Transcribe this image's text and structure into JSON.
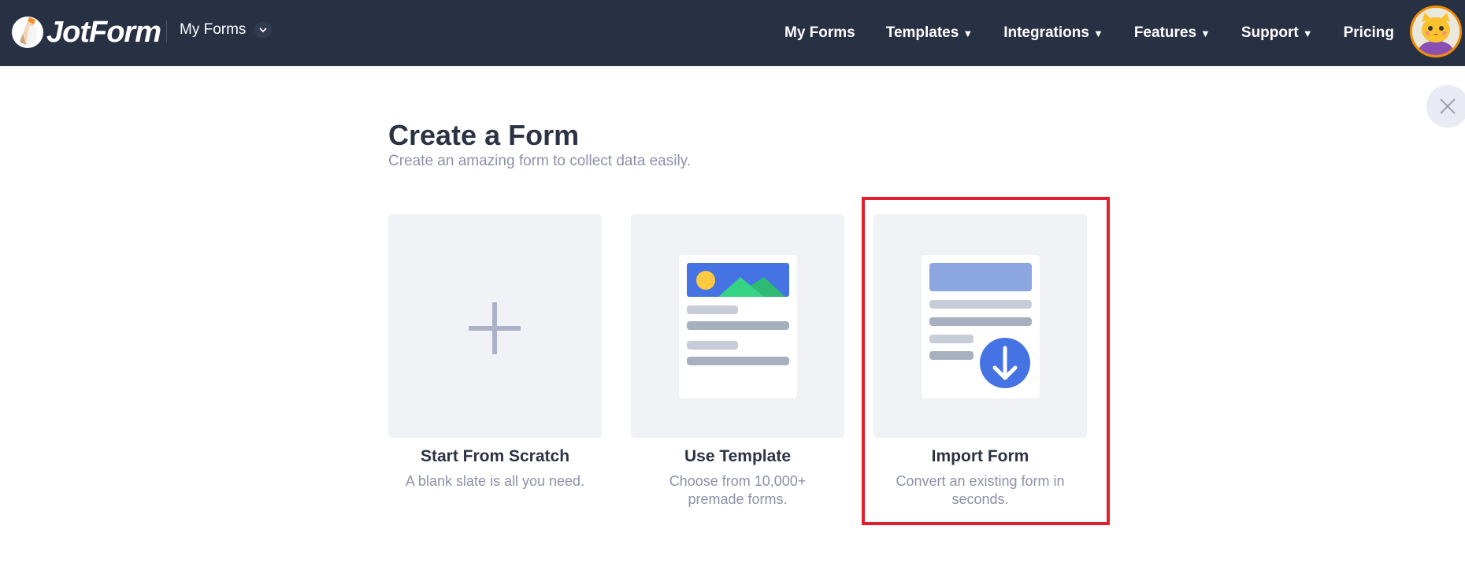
{
  "navbar": {
    "brand": "JotForm",
    "workspace_dropdown": "My Forms",
    "links": [
      {
        "label": "My Forms",
        "has_caret": false
      },
      {
        "label": "Templates",
        "has_caret": true
      },
      {
        "label": "Integrations",
        "has_caret": true
      },
      {
        "label": "Features",
        "has_caret": true
      },
      {
        "label": "Support",
        "has_caret": true
      },
      {
        "label": "Pricing",
        "has_caret": false
      }
    ],
    "caret": "▼",
    "avatar": "user-avatar-icon"
  },
  "page": {
    "title": "Create a Form",
    "subtitle": "Create an amazing form to collect data easily."
  },
  "cards": [
    {
      "title": "Start From Scratch",
      "description": "A blank slate is all you need.",
      "icon": "plus-icon"
    },
    {
      "title": "Use Template",
      "description": "Choose from 10,000+ premade forms.",
      "icon": "template-illustration-icon"
    },
    {
      "title": "Import Form",
      "description": "Convert an existing form in seconds.",
      "icon": "import-illustration-icon",
      "highlighted": true
    }
  ],
  "colors": {
    "navbar_bg": "#283044",
    "card_bg": "#f1f2f6",
    "accent_blue": "#4573e3",
    "highlight_red": "#e0202c",
    "title_text": "#2c3345",
    "muted_text": "#8d91a8"
  }
}
